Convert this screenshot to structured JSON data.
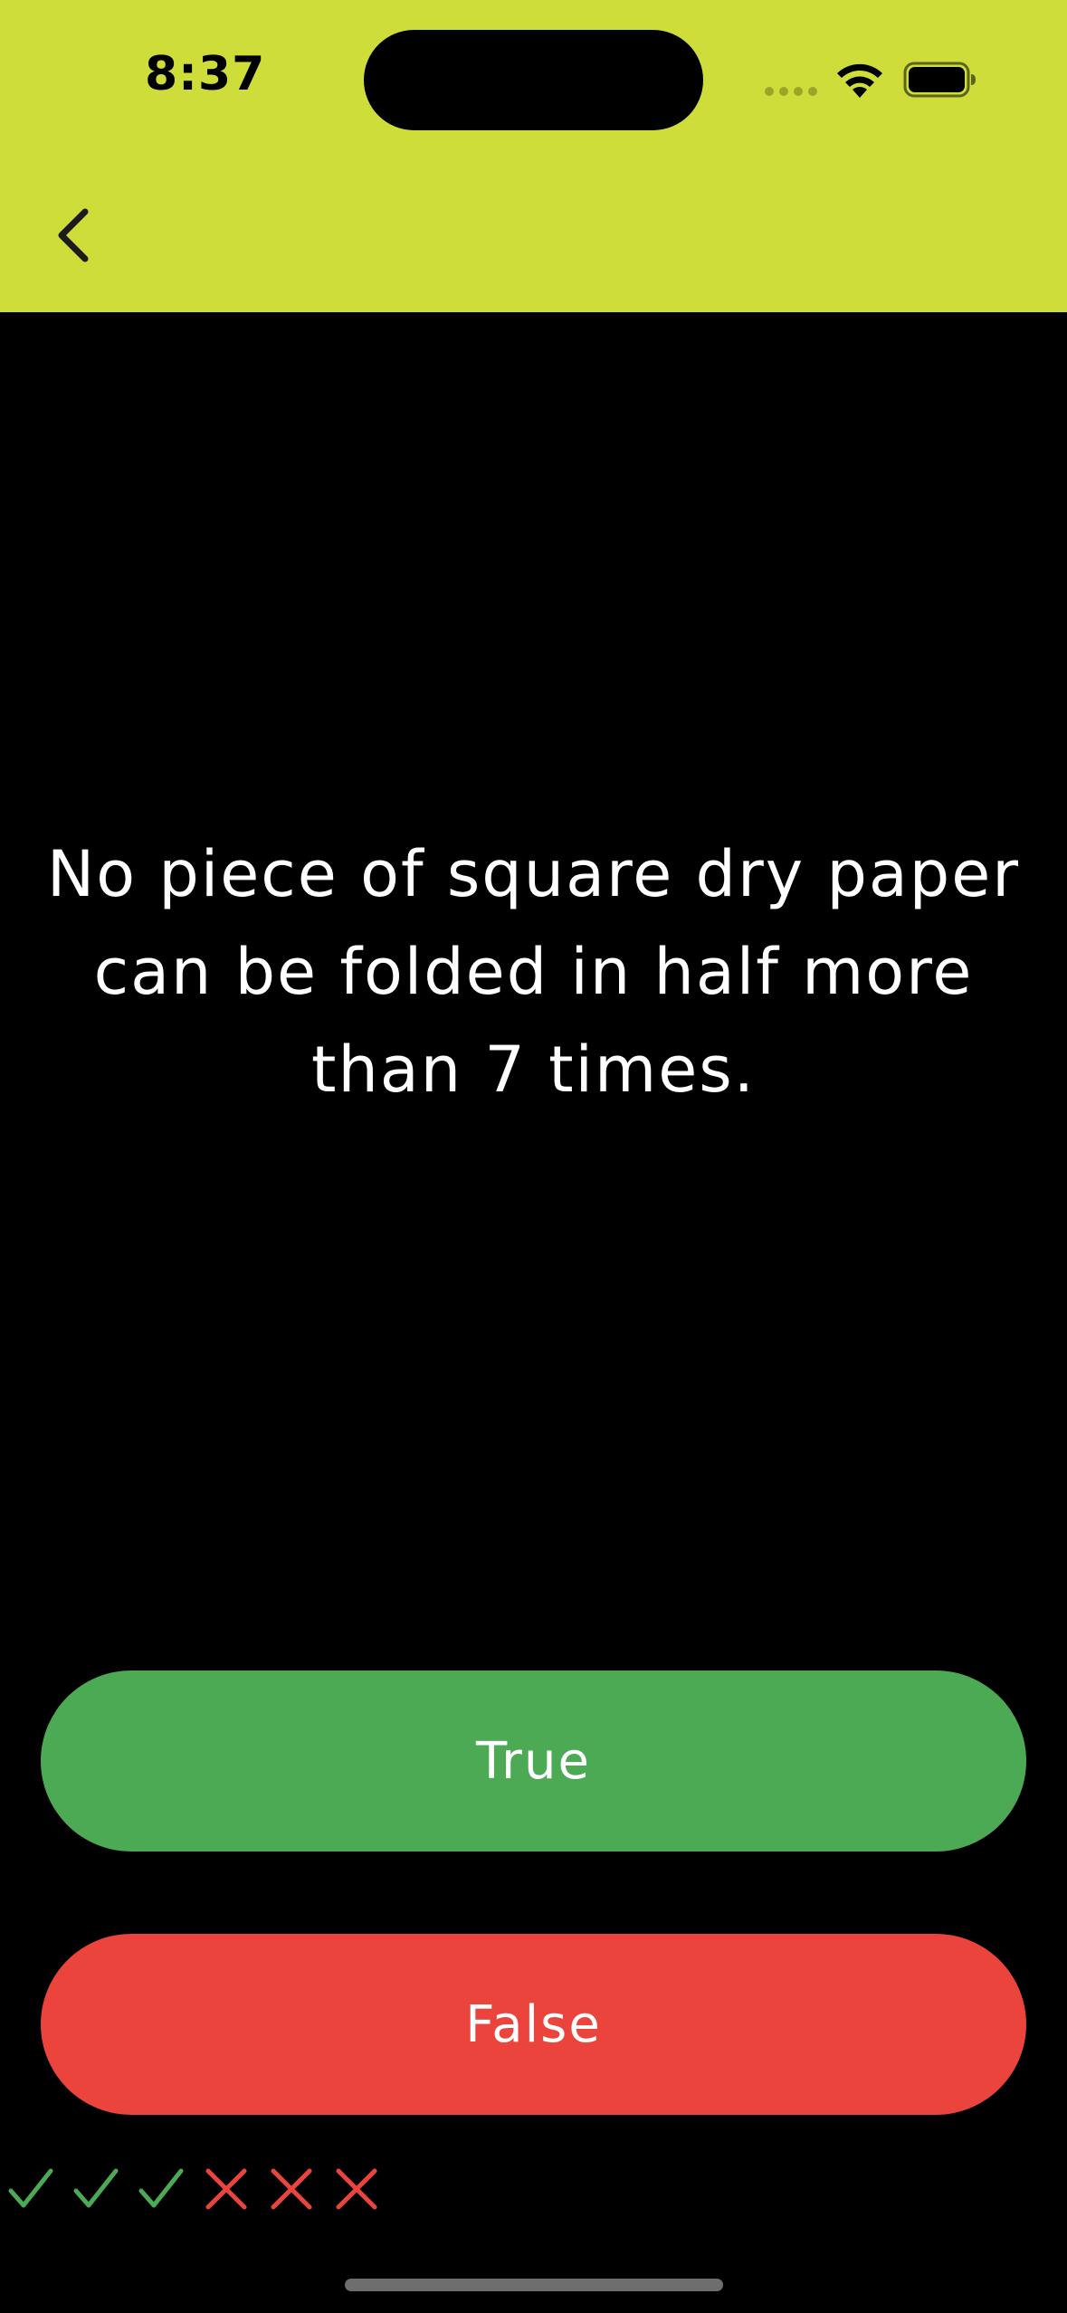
{
  "status_bar": {
    "time": "8:37",
    "icons": [
      "cellular-signal-icon",
      "wifi-icon",
      "battery-icon"
    ]
  },
  "nav": {
    "back_icon": "chevron-left-icon"
  },
  "question": {
    "text": "No piece of square dry paper can be folded in half more than 7 times."
  },
  "answers": {
    "true_label": "True",
    "false_label": "False"
  },
  "score_tracker": {
    "marks": [
      "correct",
      "correct",
      "correct",
      "wrong",
      "wrong",
      "wrong"
    ]
  },
  "colors": {
    "header_background": "#cfdd3a",
    "background": "#000000",
    "true_button": "#4caa55",
    "false_button": "#ea443c",
    "correct_mark": "#4caa55",
    "wrong_mark": "#ea443c"
  }
}
